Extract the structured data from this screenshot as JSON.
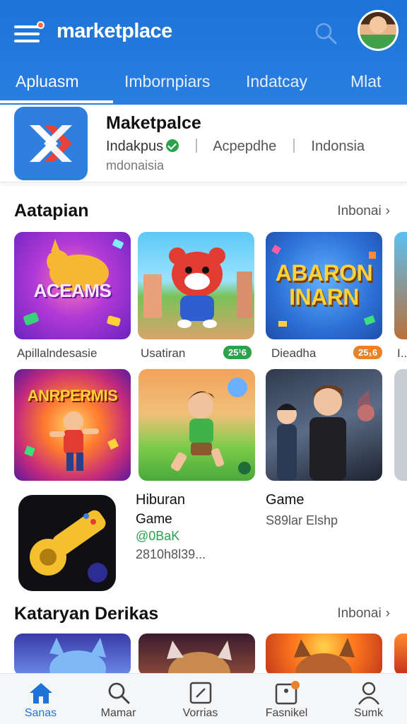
{
  "header": {
    "brand": "marketplace",
    "tabs": [
      {
        "label": "Apluasm",
        "active": true
      },
      {
        "label": "Imbornpiars",
        "active": false
      },
      {
        "label": "Indatcay",
        "active": false
      },
      {
        "label": "Mlat",
        "active": false
      }
    ]
  },
  "featured": {
    "title": "Maketpalce",
    "developer": "Indakpus",
    "category": "Acpepdhe",
    "region": "Indonsia",
    "subtitle": "mdonaisia"
  },
  "section1": {
    "title": "Aatapian",
    "link": "Inbonai",
    "tiles_row1": [
      {
        "art_text": "ACEAMS",
        "label": "Apillalndesasie",
        "badge": ""
      },
      {
        "art_text": "",
        "label": "Usatiran",
        "badge": "25¹6"
      },
      {
        "art_text": "ABARON INARN",
        "label": "Dieadha",
        "badge": "25₁6"
      },
      {
        "art_text": "",
        "label": "I...",
        "badge": ""
      }
    ],
    "tiles_row2": [
      {
        "art_text": "ANRPERMIS"
      },
      {
        "art_text": ""
      },
      {
        "art_text": ""
      }
    ]
  },
  "app_entry": {
    "name": "Hiburan",
    "type": "Game",
    "price": "@0BaK",
    "size": "2810h8l39...",
    "right_type": "Game",
    "right_sub": "S89lar Elshp"
  },
  "section2": {
    "title": "Kataryan Derikas",
    "link": "Inbonai"
  },
  "bottom_nav": [
    {
      "label": "Sanas",
      "icon": "home-icon",
      "active": true
    },
    {
      "label": "Mamar",
      "icon": "search-icon",
      "active": false
    },
    {
      "label": "Vorrias",
      "icon": "edit-square-icon",
      "active": false
    },
    {
      "label": "Fasnikel",
      "icon": "notification-box-icon",
      "active": false
    },
    {
      "label": "Sumk",
      "icon": "profile-icon",
      "active": false
    }
  ],
  "colors": {
    "header_blue": "#1e73d8",
    "accent_green": "#2ca24d",
    "accent_orange": "#e8832a"
  }
}
